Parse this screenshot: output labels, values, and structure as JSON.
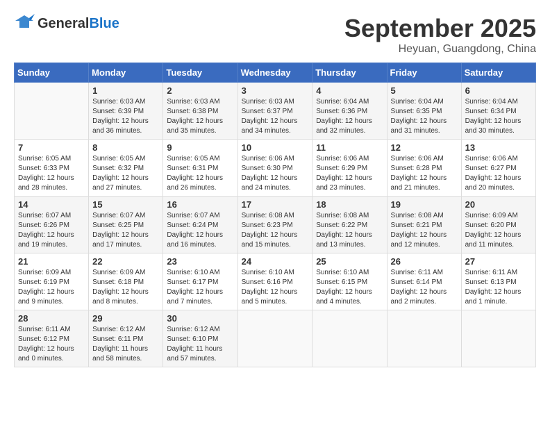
{
  "header": {
    "logo_general": "General",
    "logo_blue": "Blue",
    "month_title": "September 2025",
    "location": "Heyuan, Guangdong, China"
  },
  "weekdays": [
    "Sunday",
    "Monday",
    "Tuesday",
    "Wednesday",
    "Thursday",
    "Friday",
    "Saturday"
  ],
  "weeks": [
    [
      {
        "day": "",
        "info": ""
      },
      {
        "day": "1",
        "info": "Sunrise: 6:03 AM\nSunset: 6:39 PM\nDaylight: 12 hours\nand 36 minutes."
      },
      {
        "day": "2",
        "info": "Sunrise: 6:03 AM\nSunset: 6:38 PM\nDaylight: 12 hours\nand 35 minutes."
      },
      {
        "day": "3",
        "info": "Sunrise: 6:03 AM\nSunset: 6:37 PM\nDaylight: 12 hours\nand 34 minutes."
      },
      {
        "day": "4",
        "info": "Sunrise: 6:04 AM\nSunset: 6:36 PM\nDaylight: 12 hours\nand 32 minutes."
      },
      {
        "day": "5",
        "info": "Sunrise: 6:04 AM\nSunset: 6:35 PM\nDaylight: 12 hours\nand 31 minutes."
      },
      {
        "day": "6",
        "info": "Sunrise: 6:04 AM\nSunset: 6:34 PM\nDaylight: 12 hours\nand 30 minutes."
      }
    ],
    [
      {
        "day": "7",
        "info": "Sunrise: 6:05 AM\nSunset: 6:33 PM\nDaylight: 12 hours\nand 28 minutes."
      },
      {
        "day": "8",
        "info": "Sunrise: 6:05 AM\nSunset: 6:32 PM\nDaylight: 12 hours\nand 27 minutes."
      },
      {
        "day": "9",
        "info": "Sunrise: 6:05 AM\nSunset: 6:31 PM\nDaylight: 12 hours\nand 26 minutes."
      },
      {
        "day": "10",
        "info": "Sunrise: 6:06 AM\nSunset: 6:30 PM\nDaylight: 12 hours\nand 24 minutes."
      },
      {
        "day": "11",
        "info": "Sunrise: 6:06 AM\nSunset: 6:29 PM\nDaylight: 12 hours\nand 23 minutes."
      },
      {
        "day": "12",
        "info": "Sunrise: 6:06 AM\nSunset: 6:28 PM\nDaylight: 12 hours\nand 21 minutes."
      },
      {
        "day": "13",
        "info": "Sunrise: 6:06 AM\nSunset: 6:27 PM\nDaylight: 12 hours\nand 20 minutes."
      }
    ],
    [
      {
        "day": "14",
        "info": "Sunrise: 6:07 AM\nSunset: 6:26 PM\nDaylight: 12 hours\nand 19 minutes."
      },
      {
        "day": "15",
        "info": "Sunrise: 6:07 AM\nSunset: 6:25 PM\nDaylight: 12 hours\nand 17 minutes."
      },
      {
        "day": "16",
        "info": "Sunrise: 6:07 AM\nSunset: 6:24 PM\nDaylight: 12 hours\nand 16 minutes."
      },
      {
        "day": "17",
        "info": "Sunrise: 6:08 AM\nSunset: 6:23 PM\nDaylight: 12 hours\nand 15 minutes."
      },
      {
        "day": "18",
        "info": "Sunrise: 6:08 AM\nSunset: 6:22 PM\nDaylight: 12 hours\nand 13 minutes."
      },
      {
        "day": "19",
        "info": "Sunrise: 6:08 AM\nSunset: 6:21 PM\nDaylight: 12 hours\nand 12 minutes."
      },
      {
        "day": "20",
        "info": "Sunrise: 6:09 AM\nSunset: 6:20 PM\nDaylight: 12 hours\nand 11 minutes."
      }
    ],
    [
      {
        "day": "21",
        "info": "Sunrise: 6:09 AM\nSunset: 6:19 PM\nDaylight: 12 hours\nand 9 minutes."
      },
      {
        "day": "22",
        "info": "Sunrise: 6:09 AM\nSunset: 6:18 PM\nDaylight: 12 hours\nand 8 minutes."
      },
      {
        "day": "23",
        "info": "Sunrise: 6:10 AM\nSunset: 6:17 PM\nDaylight: 12 hours\nand 7 minutes."
      },
      {
        "day": "24",
        "info": "Sunrise: 6:10 AM\nSunset: 6:16 PM\nDaylight: 12 hours\nand 5 minutes."
      },
      {
        "day": "25",
        "info": "Sunrise: 6:10 AM\nSunset: 6:15 PM\nDaylight: 12 hours\nand 4 minutes."
      },
      {
        "day": "26",
        "info": "Sunrise: 6:11 AM\nSunset: 6:14 PM\nDaylight: 12 hours\nand 2 minutes."
      },
      {
        "day": "27",
        "info": "Sunrise: 6:11 AM\nSunset: 6:13 PM\nDaylight: 12 hours\nand 1 minute."
      }
    ],
    [
      {
        "day": "28",
        "info": "Sunrise: 6:11 AM\nSunset: 6:12 PM\nDaylight: 12 hours\nand 0 minutes."
      },
      {
        "day": "29",
        "info": "Sunrise: 6:12 AM\nSunset: 6:11 PM\nDaylight: 11 hours\nand 58 minutes."
      },
      {
        "day": "30",
        "info": "Sunrise: 6:12 AM\nSunset: 6:10 PM\nDaylight: 11 hours\nand 57 minutes."
      },
      {
        "day": "",
        "info": ""
      },
      {
        "day": "",
        "info": ""
      },
      {
        "day": "",
        "info": ""
      },
      {
        "day": "",
        "info": ""
      }
    ]
  ]
}
